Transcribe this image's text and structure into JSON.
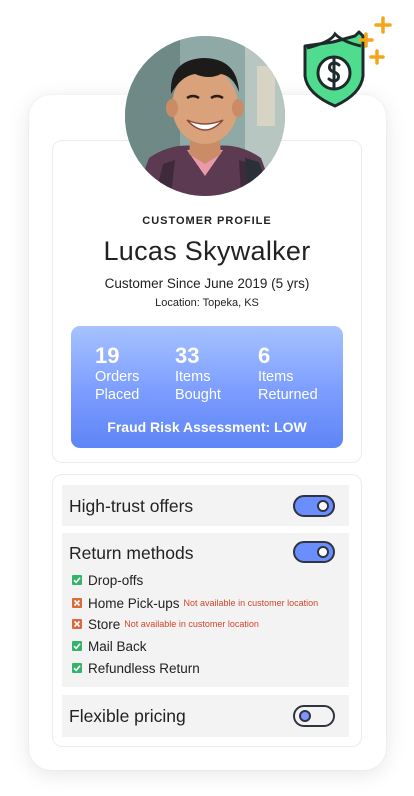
{
  "profile": {
    "eyebrow": "CUSTOMER PROFILE",
    "name": "Lucas Skywalker",
    "since": "Customer Since June 2019 (5 yrs)",
    "location": "Location: Topeka, KS"
  },
  "stats": [
    {
      "value": "19",
      "line1": "Orders",
      "line2": "Placed"
    },
    {
      "value": "33",
      "line1": "Items",
      "line2": "Bought"
    },
    {
      "value": "6",
      "line1": "Items",
      "line2": "Returned"
    }
  ],
  "fraud_label": "Fraud Risk Assessment: LOW",
  "settings": {
    "high_trust": {
      "label": "High-trust offers",
      "enabled": true
    },
    "return_methods": {
      "label": "Return methods",
      "enabled": true
    },
    "flexible_pricing": {
      "label": "Flexible pricing",
      "enabled": false
    }
  },
  "methods": [
    {
      "label": "Drop-offs",
      "available": true,
      "note": ""
    },
    {
      "label": "Home Pick-ups",
      "available": false,
      "note": "Not available in customer location"
    },
    {
      "label": "Store",
      "available": false,
      "note": "Not available in customer location"
    },
    {
      "label": "Mail Back",
      "available": true,
      "note": ""
    },
    {
      "label": "Refundless Return",
      "available": true,
      "note": ""
    }
  ],
  "colors": {
    "accent": "#6b8eff",
    "shield": "#4fdc8e",
    "sparkle": "#f4a51c",
    "available": "#35b36b",
    "unavailable": "#d96a3c",
    "note": "#d3462a"
  },
  "icons": {
    "badge": "dollar-shield-icon",
    "sparkles": "sparkle-icon",
    "available": "checkmark-icon",
    "unavailable": "cross-icon"
  }
}
